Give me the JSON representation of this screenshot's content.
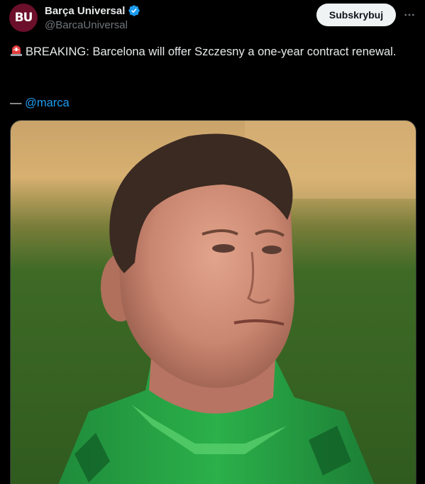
{
  "account": {
    "display_name": "Barça Universal",
    "handle": "@BarcaUniversal",
    "avatar_text": "BU",
    "verified": true
  },
  "actions": {
    "subscribe_label": "Subskrybuj"
  },
  "tweet": {
    "text": "BREAKING: Barcelona will offer Szczesny a one-year contract renewal.",
    "source_prefix": "— ",
    "source_handle": "@marca"
  },
  "colors": {
    "background": "#000000",
    "text": "#e7e9ea",
    "secondary_text": "#71767b",
    "link": "#1d9bf0",
    "verified": "#1d9bf0",
    "avatar_bg": "#6b0f2a"
  },
  "icons": {
    "alarm": "rotating-light-icon",
    "verified": "verified-badge-icon",
    "more": "more-horizontal-icon"
  }
}
